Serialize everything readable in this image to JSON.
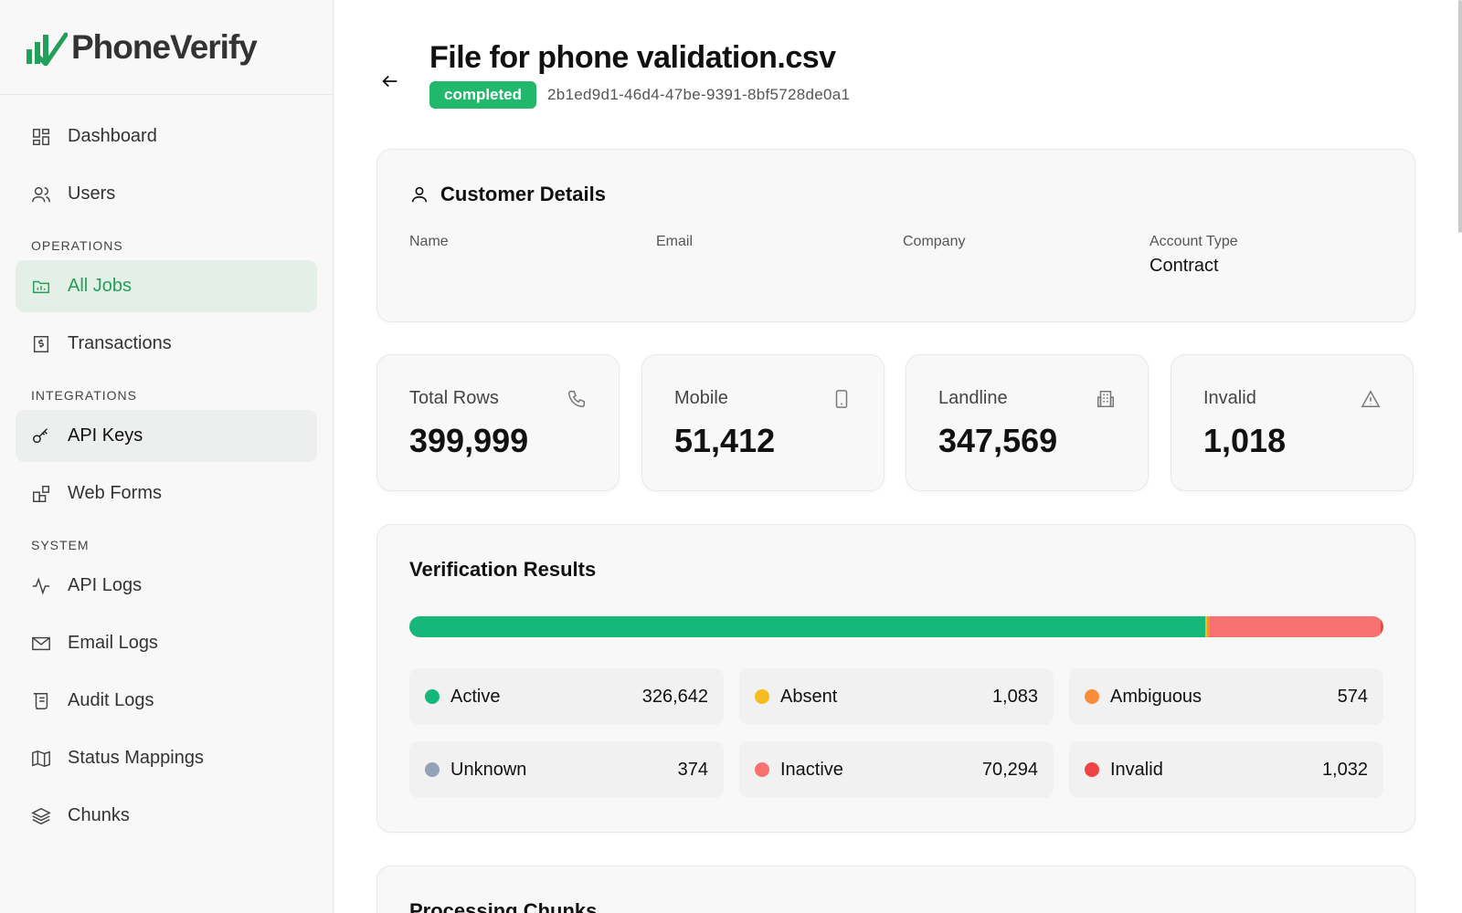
{
  "brand": {
    "name": "PhoneVerify",
    "color": "#22a05a"
  },
  "sidebar": {
    "top_items": [
      {
        "label": "Dashboard",
        "icon": "dashboard-icon"
      },
      {
        "label": "Users",
        "icon": "users-icon"
      }
    ],
    "sections": [
      {
        "label": "OPERATIONS",
        "items": [
          {
            "label": "All Jobs",
            "icon": "folder-icon",
            "active": true
          },
          {
            "label": "Transactions",
            "icon": "receipt-icon"
          }
        ]
      },
      {
        "label": "INTEGRATIONS",
        "items": [
          {
            "label": "API Keys",
            "icon": "key-icon"
          },
          {
            "label": "Web Forms",
            "icon": "forms-icon"
          }
        ]
      },
      {
        "label": "SYSTEM",
        "items": [
          {
            "label": "API Logs",
            "icon": "activity-icon"
          },
          {
            "label": "Email Logs",
            "icon": "mail-icon"
          },
          {
            "label": "Audit Logs",
            "icon": "scroll-icon"
          },
          {
            "label": "Status Mappings",
            "icon": "map-icon"
          },
          {
            "label": "Chunks",
            "icon": "layers-icon"
          }
        ]
      }
    ]
  },
  "header": {
    "title": "File for phone validation.csv",
    "status": "completed",
    "job_id": "2b1ed9d1-46d4-47be-9391-8bf5728de0a1"
  },
  "customer": {
    "heading": "Customer Details",
    "fields": [
      {
        "label": "Name",
        "value": ""
      },
      {
        "label": "Email",
        "value": ""
      },
      {
        "label": "Company",
        "value": ""
      },
      {
        "label": "Account Type",
        "value": "Contract"
      }
    ]
  },
  "stats": [
    {
      "label": "Total Rows",
      "value": "399,999",
      "icon": "phone-icon"
    },
    {
      "label": "Mobile",
      "value": "51,412",
      "icon": "smartphone-icon"
    },
    {
      "label": "Landline",
      "value": "347,569",
      "icon": "building-icon"
    },
    {
      "label": "Invalid",
      "value": "1,018",
      "icon": "warning-icon"
    }
  ],
  "results": {
    "heading": "Verification Results",
    "items": [
      {
        "label": "Active",
        "count": "326,642",
        "value": 326642,
        "color": "#16b87a"
      },
      {
        "label": "Absent",
        "count": "1,083",
        "value": 1083,
        "color": "#f5bd1f"
      },
      {
        "label": "Ambiguous",
        "count": "574",
        "value": 574,
        "color": "#fb8c3a"
      },
      {
        "label": "Unknown",
        "count": "374",
        "value": 374,
        "color": "#94a3b8"
      },
      {
        "label": "Inactive",
        "count": "70,294",
        "value": 70294,
        "color": "#f87171"
      },
      {
        "label": "Invalid",
        "count": "1,032",
        "value": 1032,
        "color": "#ef4444"
      }
    ]
  },
  "chunks": {
    "heading": "Processing Chunks"
  }
}
